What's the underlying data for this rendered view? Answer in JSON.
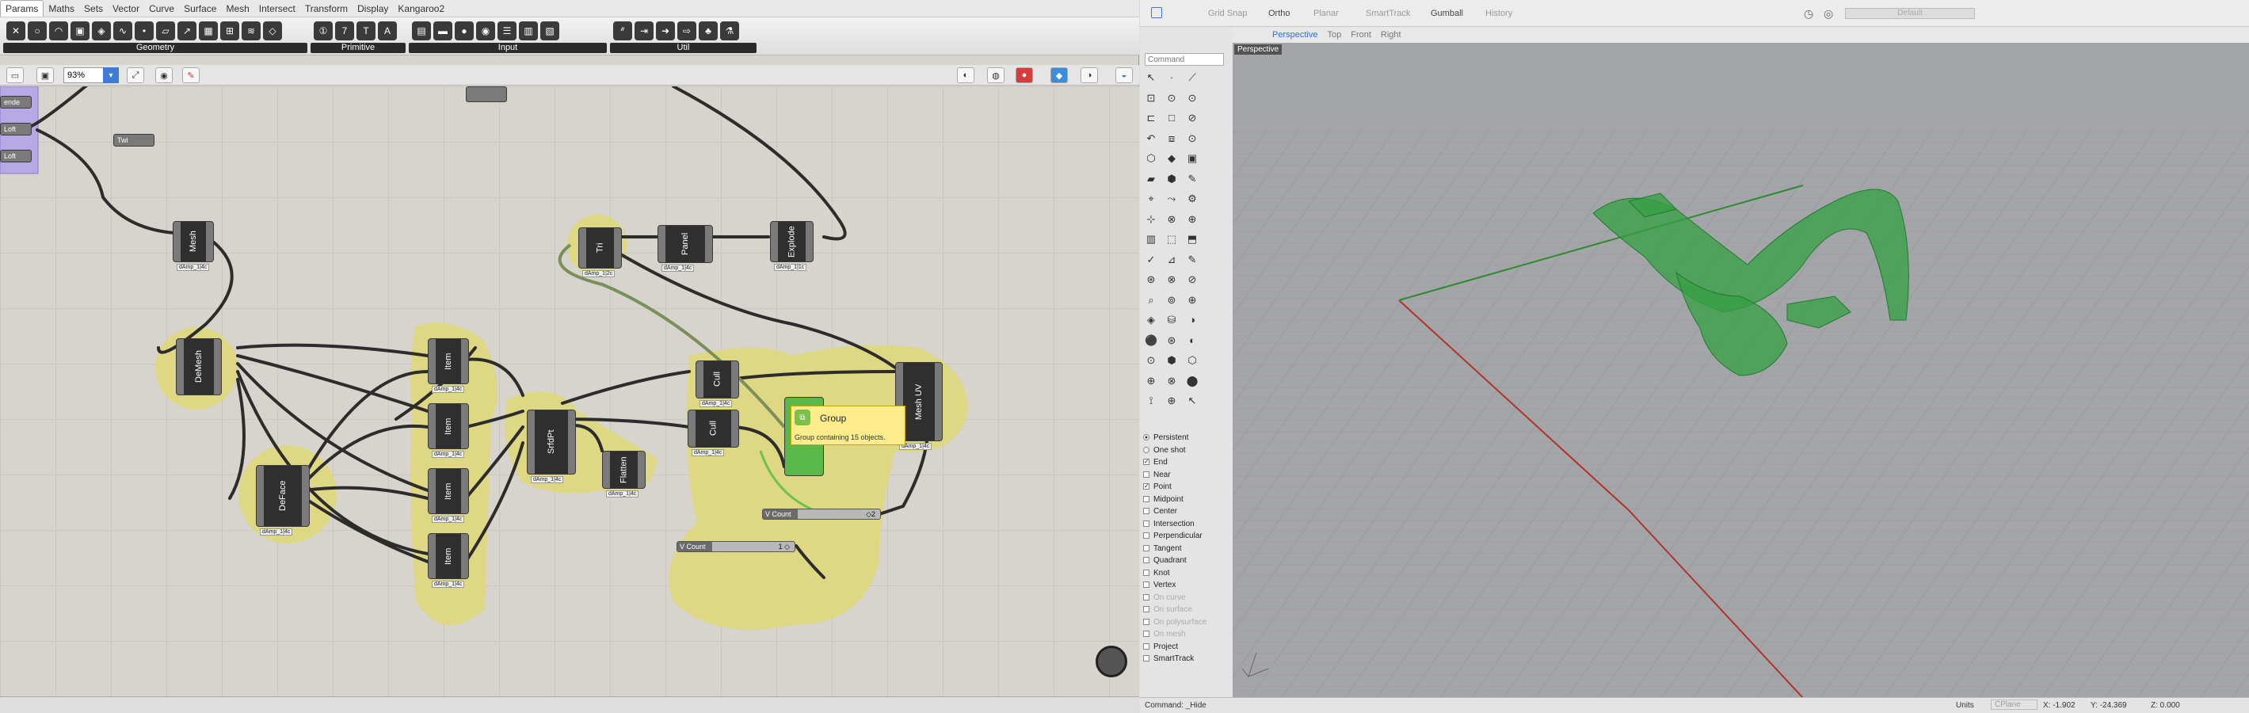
{
  "gh": {
    "tabs": [
      "Params",
      "Maths",
      "Sets",
      "Vector",
      "Curve",
      "Surface",
      "Mesh",
      "Intersect",
      "Transform",
      "Display",
      "Kangaroo2"
    ],
    "ribbon_groups": [
      {
        "label": "Geometry",
        "icons": [
          "x-icon",
          "circle-icon",
          "arc-icon",
          "box-icon",
          "brep-icon",
          "curve-icon",
          "point-icon",
          "plane-icon",
          "vector-icon",
          "surface-icon",
          "mesh-icon",
          "field-icon",
          "twisted-box-icon"
        ]
      },
      {
        "label": "Primitive",
        "icons": [
          "integer-icon",
          "number-icon",
          "text-icon",
          "boolean-icon"
        ]
      },
      {
        "label": "Input",
        "icons": [
          "panel-icon",
          "slider-icon",
          "color-icon",
          "graph-icon",
          "list-icon",
          "gradient-icon",
          "toggle-icon"
        ]
      },
      {
        "label": "Util",
        "icons": [
          "cherry-icon",
          "jump-icon",
          "arrow-icon",
          "relay-icon",
          "fruit-icon",
          "flask-icon"
        ]
      }
    ],
    "zoom": "93%",
    "components": [
      {
        "name": "Mesh",
        "tag": "dAmp_1|4c"
      },
      {
        "name": "Tri",
        "tag": "dAmp_1|2c"
      },
      {
        "name": "Panel",
        "tag": "dAmp_1|4c"
      },
      {
        "name": "Explode",
        "tag": "dAmp_1|1c"
      },
      {
        "name": "DeMesh",
        "tag": ""
      },
      {
        "name": "Item",
        "tag": "dAmp_1|4c"
      },
      {
        "name": "Item",
        "tag": "dAmp_1|4c"
      },
      {
        "name": "Item",
        "tag": "dAmp_1|4c"
      },
      {
        "name": "Item",
        "tag": "dAmp_1|4c"
      },
      {
        "name": "SrfdPt",
        "tag": "dAmp_1|4c"
      },
      {
        "name": "Flatten",
        "tag": "dAmp_1|4c"
      },
      {
        "name": "Cull",
        "tag": "dAmp_1|4c"
      },
      {
        "name": "Cull",
        "tag": "dAmp_1|4c"
      },
      {
        "name": "Mesh UV",
        "tag": "dAmp_1|4c"
      },
      {
        "name": "DeFace",
        "tag": "dAmp_1|4c"
      }
    ],
    "params": {
      "p1": "ende",
      "p2": "Loft",
      "p3": "Loft",
      "toggle": "Twi"
    },
    "sliders": [
      {
        "label": "V Count",
        "value": "◇2"
      },
      {
        "label": "V Count",
        "value": "1 ◇"
      }
    ],
    "tooltip": {
      "title": "Group",
      "desc": "Group containing 15 objects."
    }
  },
  "rhino": {
    "modes": [
      "Grid Snap",
      "Ortho",
      "Planar",
      "SmartTrack",
      "Gumball",
      "History"
    ],
    "active_modes": [
      "Ortho",
      "Gumball"
    ],
    "layer": "Default",
    "viewport_tabs": [
      "Perspective",
      "Top",
      "Front",
      "Right"
    ],
    "active_viewport": "Perspective",
    "command_placeholder": "Command",
    "viewport_label": "Perspective",
    "osnaps": [
      {
        "label": "Persistent",
        "kind": "radio",
        "checked": true
      },
      {
        "label": "One shot",
        "kind": "radio",
        "checked": false
      },
      {
        "label": "End",
        "kind": "check",
        "checked": true
      },
      {
        "label": "Near",
        "kind": "check",
        "checked": false
      },
      {
        "label": "Point",
        "kind": "check",
        "checked": true
      },
      {
        "label": "Midpoint",
        "kind": "check",
        "checked": false
      },
      {
        "label": "Center",
        "kind": "check",
        "checked": false
      },
      {
        "label": "Intersection",
        "kind": "check",
        "checked": false
      },
      {
        "label": "Perpendicular",
        "kind": "check",
        "checked": false
      },
      {
        "label": "Tangent",
        "kind": "check",
        "checked": false
      },
      {
        "label": "Quadrant",
        "kind": "check",
        "checked": false
      },
      {
        "label": "Knot",
        "kind": "check",
        "checked": false
      },
      {
        "label": "Vertex",
        "kind": "check",
        "checked": false
      },
      {
        "label": "On curve",
        "kind": "check",
        "checked": false,
        "dim": true
      },
      {
        "label": "On surface",
        "kind": "check",
        "checked": false,
        "dim": true
      },
      {
        "label": "On polysurface",
        "kind": "check",
        "checked": false,
        "dim": true
      },
      {
        "label": "On mesh",
        "kind": "check",
        "checked": false,
        "dim": true
      },
      {
        "label": "Project",
        "kind": "check",
        "checked": false
      },
      {
        "label": "SmartTrack",
        "kind": "check",
        "checked": false
      }
    ],
    "status": {
      "command": "Command: _Hide",
      "units": "Units",
      "cplane": "CPlane",
      "x": "X: -1.902",
      "y": "Y: -24.369",
      "z": "Z: 0.000"
    },
    "colors": {
      "x_axis": "#b0332a",
      "y_axis": "#2e8a2e",
      "surface": "#34a043",
      "viewport_bg": "#a4a5a8"
    }
  }
}
